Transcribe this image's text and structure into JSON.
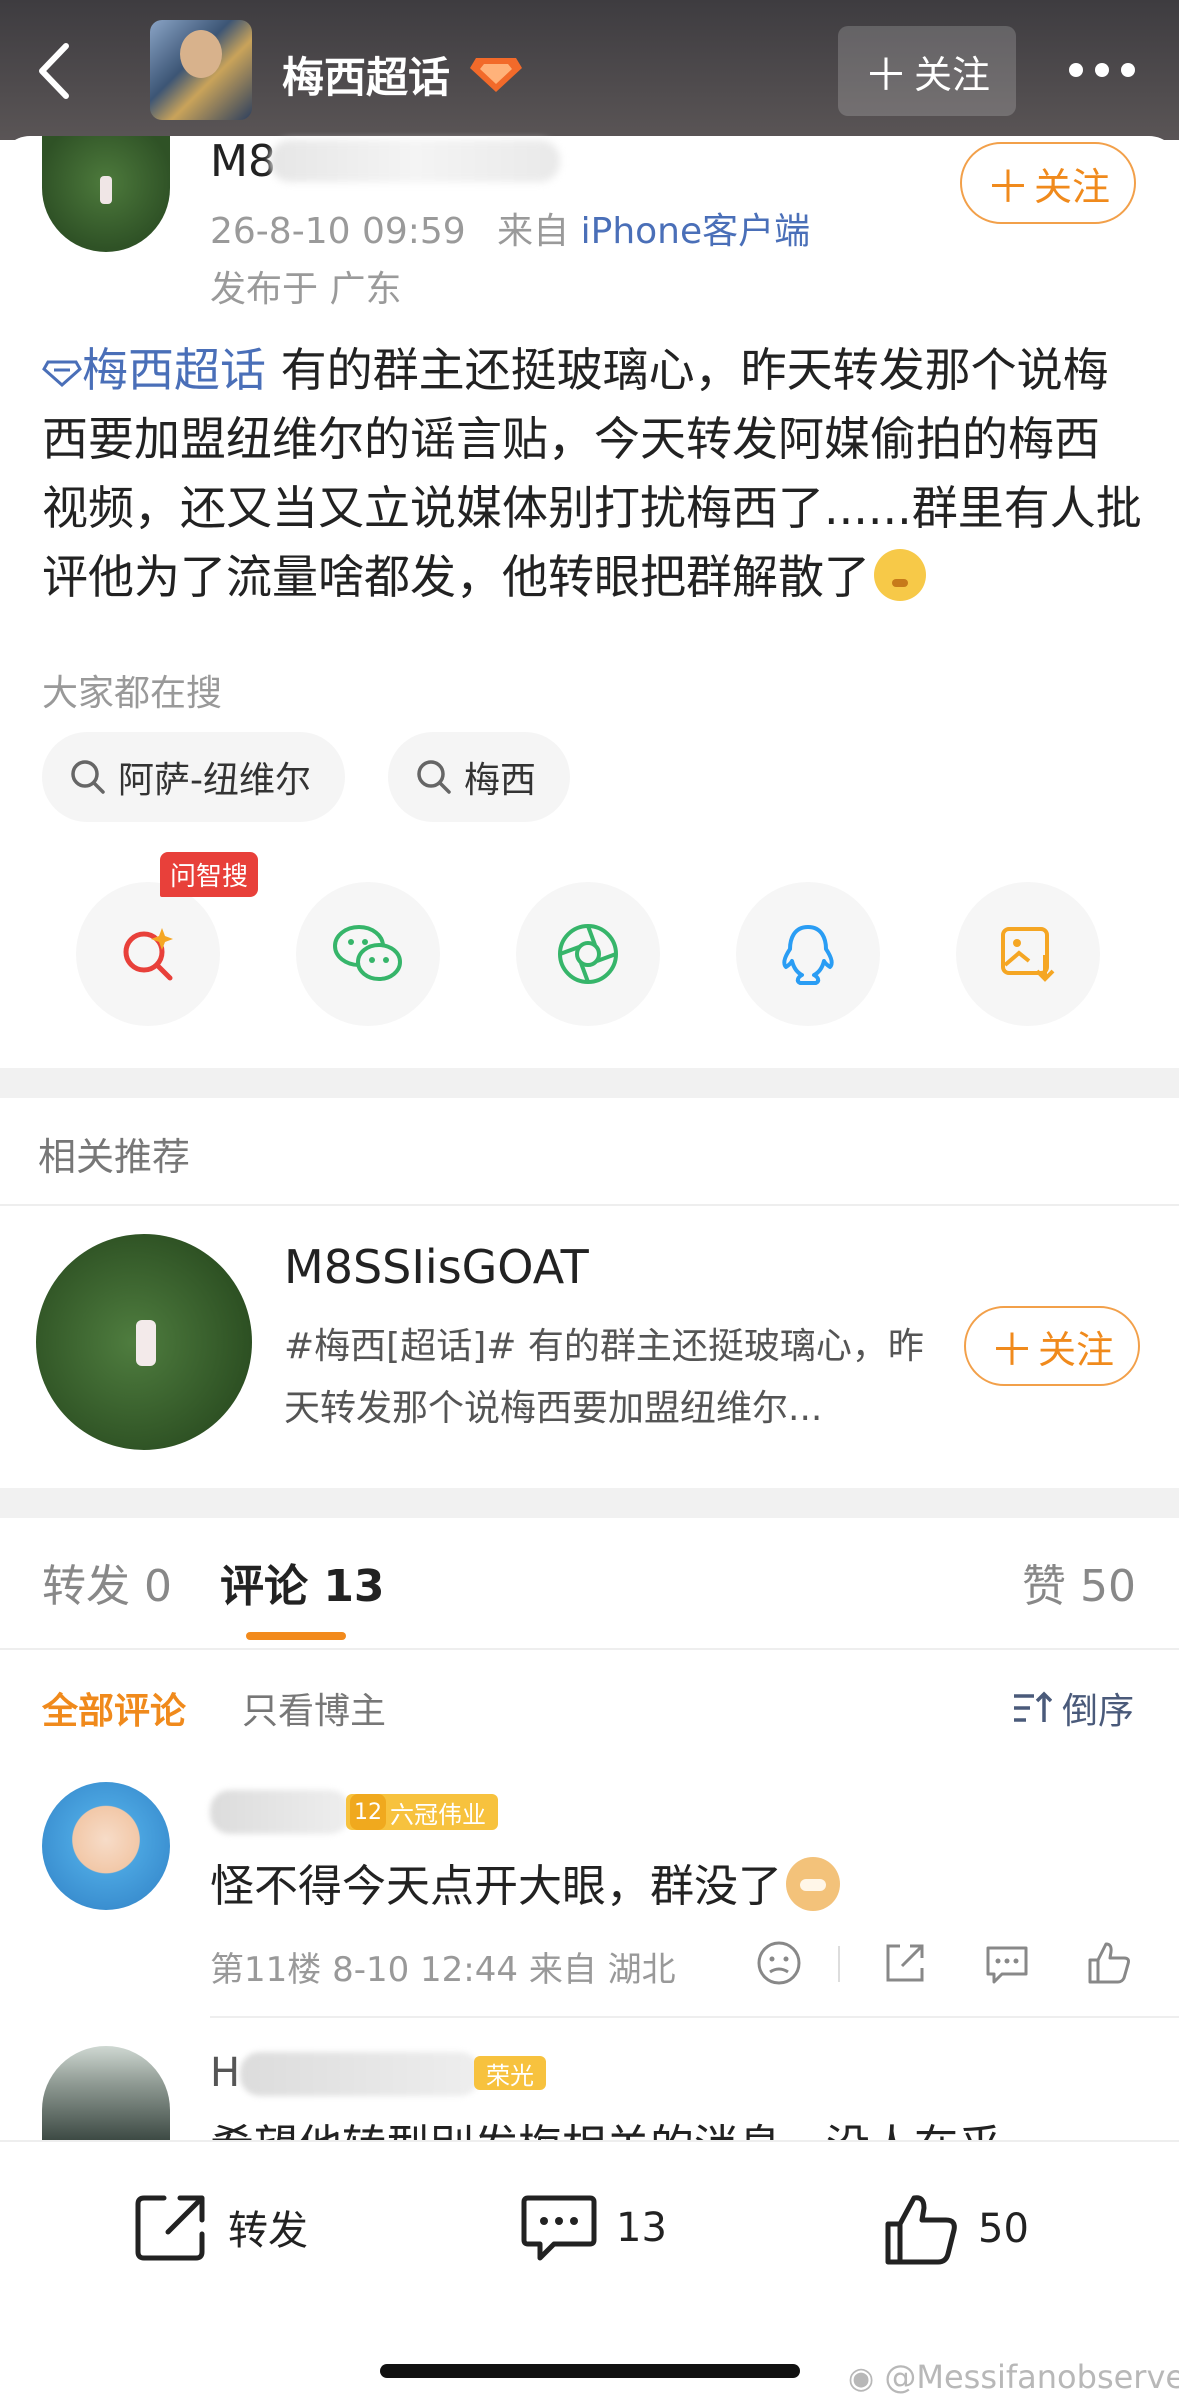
{
  "header": {
    "title": "梅西超话",
    "follow_label": "关注"
  },
  "post": {
    "author_prefix": "M8",
    "date": "26-8-10 09:59",
    "from_label": "来自",
    "source": "iPhone客户端",
    "location": "发布于 广东",
    "follow_label": "关注",
    "topic_tag": "梅西超话",
    "body": " 有的群主还挺玻璃心，昨天转发那个说梅西要加盟纽维尔的谣言贴，今天转发阿媒偷拍的梅西视频，还又当又立说媒体别打扰梅西了......群里有人批评他为了流量啥都发，他转眼把群解散了"
  },
  "search_hint": {
    "title": "大家都在搜",
    "chips": [
      "阿萨-纽维尔",
      "梅西"
    ]
  },
  "share": {
    "ai_badge": "问智搜",
    "icons": [
      "ai-search-icon",
      "wechat-icon",
      "moments-icon",
      "qq-icon",
      "save-image-icon"
    ]
  },
  "recommend": {
    "title": "相关推荐",
    "name": "M8SSIisGOAT",
    "desc": "#梅西[超话]# 有的群主还挺玻璃心，昨天转发那个说梅西要加盟纽维尔...",
    "follow_label": "关注"
  },
  "tabs": {
    "repost": "转发 0",
    "comments": "评论 13",
    "likes": "赞 50"
  },
  "filters": {
    "all": "全部评论",
    "author_only": "只看博主",
    "sort": "倒序"
  },
  "comments": [
    {
      "badge_level": "12",
      "badge_text": "六冠伟业",
      "text": "怪不得今天点开大眼，群没了",
      "meta": "第11楼 8-10 12:44 来自 湖北"
    },
    {
      "name_prefix": "H",
      "badge_text": "荣光",
      "text": "希望他转型别发梅相关的消息，没人在乎"
    }
  ],
  "bottom_bar": {
    "repost_label": "转发",
    "comment_count": "13",
    "like_count": "50"
  },
  "watermark": "@Messifanobserver",
  "colors": {
    "accent_orange": "#f08a1c",
    "link_blue": "#4a6fb8",
    "header_bg": "#4a4648"
  }
}
